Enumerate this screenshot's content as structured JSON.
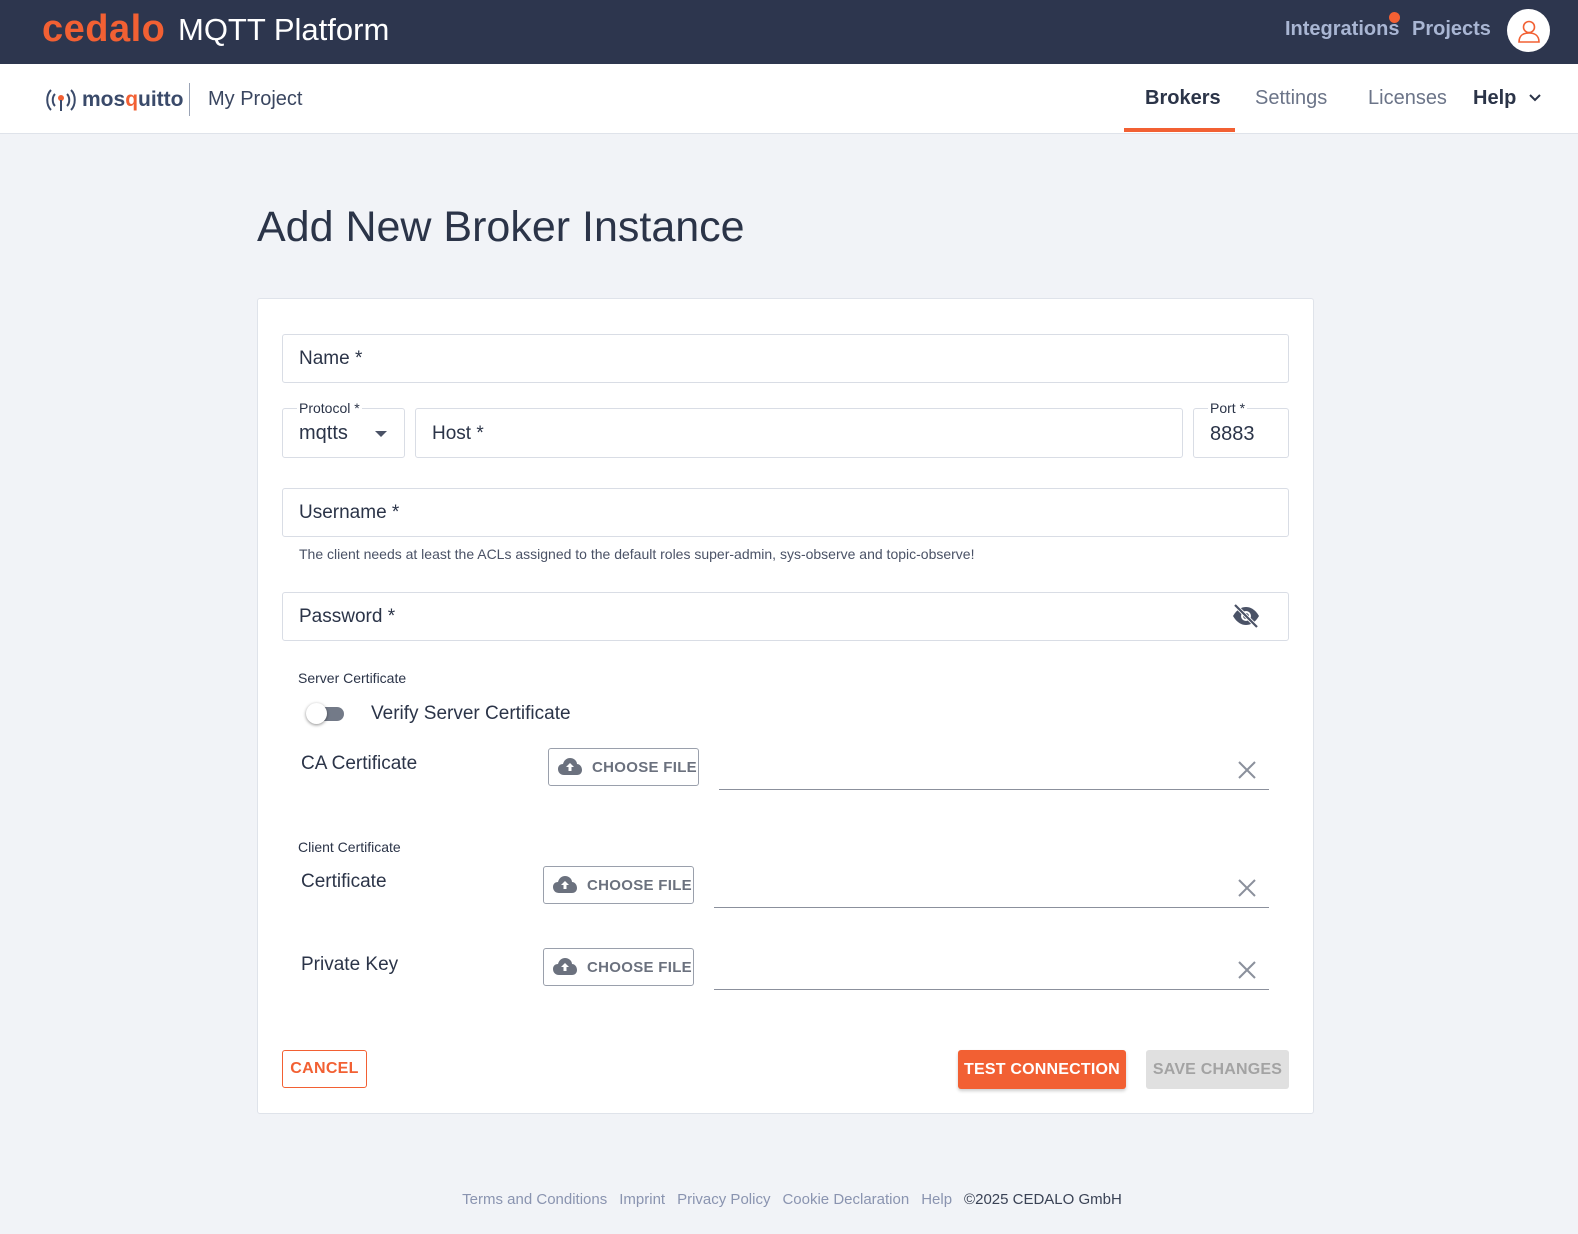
{
  "topbar": {
    "logo": "cedalo",
    "title": "MQTT Platform",
    "integrations": "Integrations",
    "projects": "Projects"
  },
  "subbar": {
    "logo_prefix": "mos",
    "logo_o": "q",
    "logo_suffix": "uitto",
    "project": "My Project",
    "tabs": [
      {
        "label": "Brokers",
        "active": true
      },
      {
        "label": "Settings",
        "active": false
      },
      {
        "label": "Licenses",
        "active": false
      },
      {
        "label": "Help",
        "active": false
      }
    ]
  },
  "page": {
    "title": "Add New Broker Instance"
  },
  "form": {
    "name_label": "Name *",
    "protocol_label": "Protocol *",
    "protocol_value": "mqtts",
    "host_label": "Host *",
    "port_label": "Port *",
    "port_value": "8883",
    "username_label": "Username *",
    "username_helper": "The client needs at least the ACLs assigned to the default roles super-admin, sys-observe and topic-observe!",
    "password_label": "Password *",
    "server_cert_section": "Server Certificate",
    "verify_label": "Verify Server Certificate",
    "verify_enabled": false,
    "ca_cert_label": "CA Certificate",
    "client_cert_section": "Client Certificate",
    "cert_label": "Certificate",
    "private_key_label": "Private Key",
    "choose_file": "CHOOSE FILE"
  },
  "actions": {
    "cancel": "CANCEL",
    "test": "TEST CONNECTION",
    "save": "SAVE CHANGES"
  },
  "footer": {
    "links": [
      "Terms and Conditions",
      "Imprint",
      "Privacy Policy",
      "Cookie Declaration",
      "Help"
    ],
    "copyright": "©2025 CEDALO GmbH"
  },
  "colors": {
    "accent": "#f26033",
    "topbar": "#2d364e",
    "background": "#f1f3f7"
  }
}
